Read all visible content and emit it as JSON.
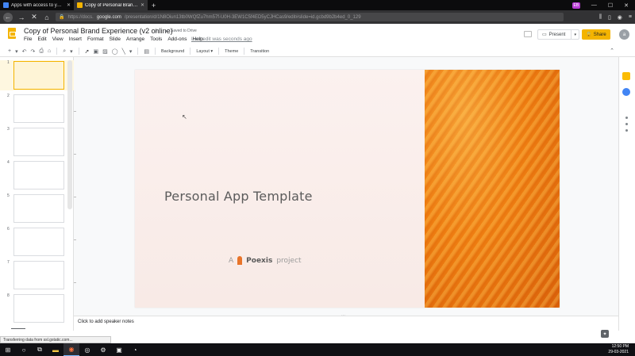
{
  "browser": {
    "tabs": [
      {
        "label": "Apps with access to your accou...",
        "active": false,
        "favicon_color": "#4285f4"
      },
      {
        "label": "Copy of Personal Brand Experie...",
        "active": true,
        "favicon_color": "#f4b400"
      }
    ],
    "new_tab": "+",
    "window_controls": {
      "profile": "EB",
      "minimize": "—",
      "maximize": "☐",
      "close": "✕"
    },
    "url": {
      "prefix": "https://docs.",
      "host": "google.com",
      "path": "/presentation/d/1N8Oiun13tb0WQfZu7hm57f-U0H-3EW1C5f4ED5yCJHCas9/edit#slide=id.gcbd9b2b4ed_0_129"
    }
  },
  "app": {
    "title": "Copy of Personal Brand Experience (v2 online)",
    "saved_status": "Saved to Drive",
    "menus": [
      "File",
      "Edit",
      "View",
      "Insert",
      "Format",
      "Slide",
      "Arrange",
      "Tools",
      "Add-ons",
      "Help"
    ],
    "last_edit": "Last edit was seconds ago",
    "present_label": "Present",
    "share_label": "Share",
    "avatar_letter": "a",
    "accent_color": "#f4b400"
  },
  "toolbar": {
    "background": "Background",
    "layout": "Layout ▾",
    "theme": "Theme",
    "transition": "Transition"
  },
  "filmstrip": {
    "slides": [
      "1",
      "2",
      "3",
      "4",
      "5",
      "6",
      "7",
      "8"
    ],
    "selected": "1"
  },
  "slide": {
    "title": "Personal App Template",
    "byline_prefix": "A",
    "brand": "Poexis",
    "byline_suffix": "project",
    "image_color": "#ef7f12"
  },
  "notes": {
    "placeholder": "Click to add speaker notes"
  },
  "status_bar": {
    "text": "Transferring data from ssl.gstatic.com..."
  },
  "taskbar": {
    "time": "12:50 PM",
    "date": "29-03-2021"
  }
}
